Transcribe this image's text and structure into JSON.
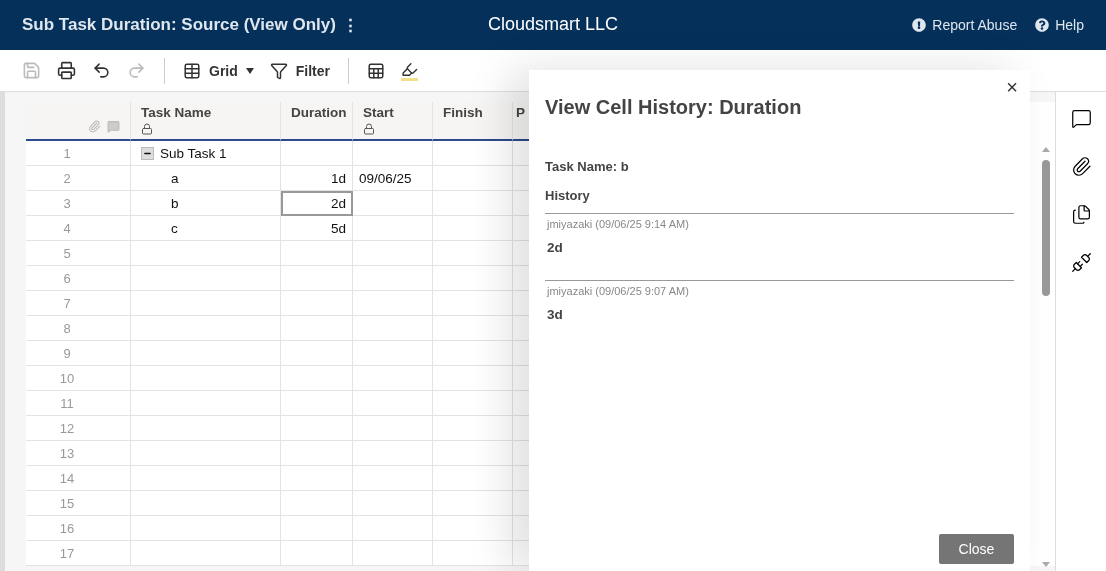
{
  "header": {
    "title": "Sub Task Duration: Source (View Only)",
    "menu_glyph": "⋮",
    "company": "Cloudsmart LLC",
    "links": [
      {
        "label": "Report Abuse",
        "kind": "abuse"
      },
      {
        "label": "Help",
        "kind": "help"
      }
    ]
  },
  "toolbar": {
    "save_disabled": true,
    "redo_disabled": true,
    "view": "Grid",
    "filter": "Filter"
  },
  "grid": {
    "columns": [
      {
        "label": "Task Name",
        "locked": true
      },
      {
        "label": "Duration",
        "locked": false
      },
      {
        "label": "Start",
        "locked": true
      },
      {
        "label": "Finish",
        "locked": false
      },
      {
        "label": "P",
        "locked": false
      }
    ],
    "rows": [
      {
        "number": "1",
        "task": "Sub Task 1",
        "selected": false,
        "expanded": true,
        "children": [
          {
            "number": "2",
            "task": "a",
            "duration": "1d",
            "start": "09/06/25",
            "selected": false
          },
          {
            "number": "3",
            "task": "b",
            "duration": "2d",
            "selected": true
          },
          {
            "number": "4",
            "task": "c",
            "duration": "5d",
            "selected": false
          }
        ]
      }
    ],
    "empty_rows": [
      "5",
      "6",
      "7",
      "8",
      "9",
      "10",
      "11",
      "12",
      "13",
      "14",
      "15",
      "16",
      "17"
    ]
  },
  "dialog": {
    "close_glyph": "×",
    "title": "View Cell History: Duration",
    "task_label": "Task Name: b",
    "history_heading": "History",
    "entries": [
      {
        "author": "jmiyazaki (09/06/25 9:14 AM)",
        "value": "2d"
      },
      {
        "author": "jmiyazaki (09/06/25 9:07 AM)",
        "value": "3d"
      }
    ],
    "button": "Close"
  }
}
